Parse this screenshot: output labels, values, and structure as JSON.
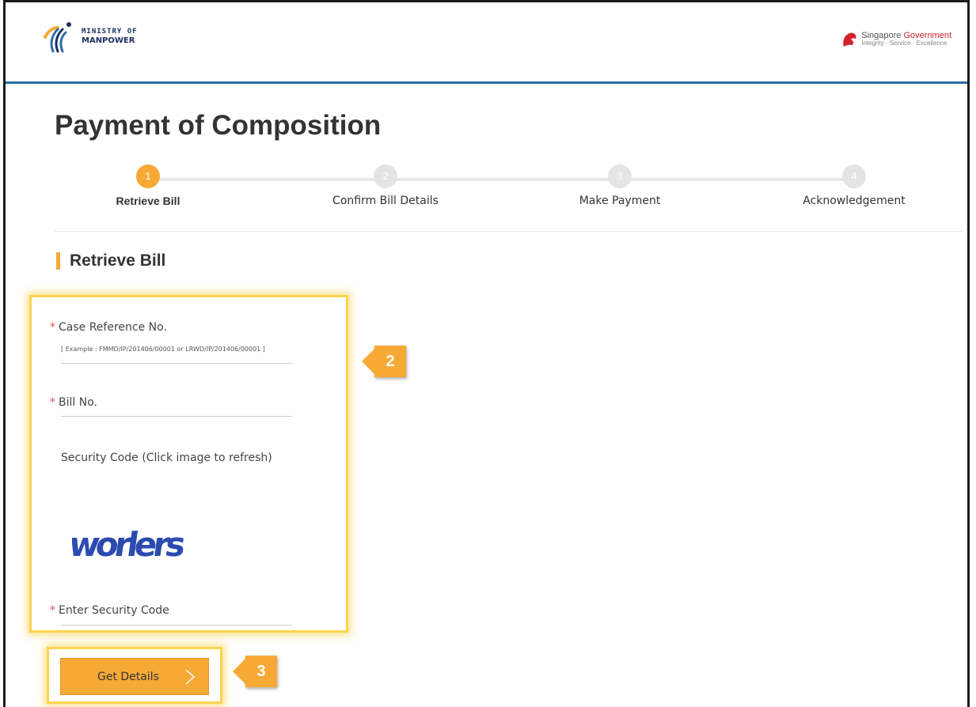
{
  "header": {
    "ministry_line1": "MINISTRY OF",
    "ministry_line2": "MANPOWER",
    "gov_text_1": "Singapore ",
    "gov_text_2": "Government",
    "gov_tagline": "Integrity · Service · Excellence"
  },
  "page": {
    "title": "Payment of Composition"
  },
  "steps": [
    {
      "number": "1",
      "label": "Retrieve Bill",
      "active": true
    },
    {
      "number": "2",
      "label": "Confirm Bill Details",
      "active": false
    },
    {
      "number": "3",
      "label": "Make Payment",
      "active": false
    },
    {
      "number": "4",
      "label": "Acknowledgement",
      "active": false
    }
  ],
  "section": {
    "title": "Retrieve Bill"
  },
  "form": {
    "required_marker": "*",
    "case_ref_label": "Case Reference No.",
    "case_ref_hint": "[ Example : FMMD/IP/201406/00001 or LRWD/IP/201406/00001 ]",
    "case_ref_value": "",
    "bill_no_label": "Bill No.",
    "bill_no_value": "",
    "security_label": "Security Code (Click image to refresh)",
    "captcha_text": "worlers",
    "enter_code_label": "Enter Security Code",
    "enter_code_value": ""
  },
  "button": {
    "get_details": "Get Details"
  },
  "callouts": {
    "form": "2",
    "button": "3"
  },
  "colors": {
    "accent": "#f7a936",
    "header_border": "#2a6ea6",
    "highlight": "#f9d451",
    "required": "#d9534f"
  }
}
